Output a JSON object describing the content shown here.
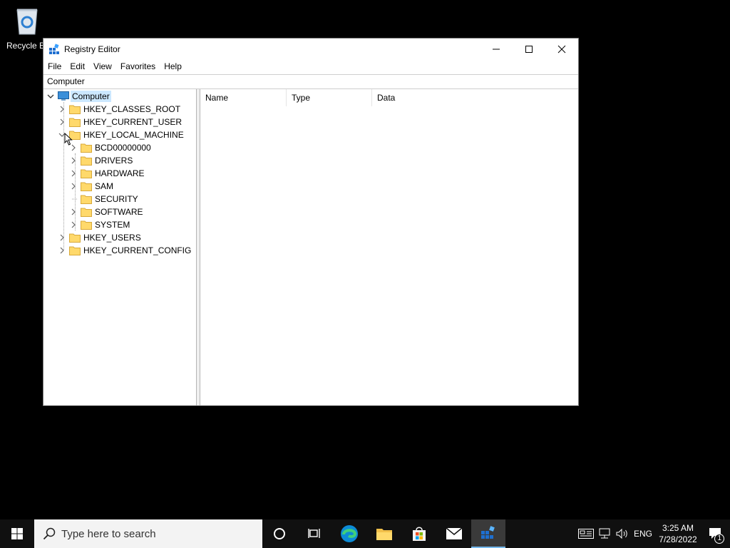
{
  "desktop": {
    "recycle_bin_label": "Recycle B"
  },
  "window": {
    "title": "Registry Editor",
    "menus": [
      "File",
      "Edit",
      "View",
      "Favorites",
      "Help"
    ],
    "address": "Computer",
    "tree": {
      "root": "Computer",
      "hives": [
        {
          "label": "HKEY_CLASSES_ROOT"
        },
        {
          "label": "HKEY_CURRENT_USER"
        },
        {
          "label": "HKEY_LOCAL_MACHINE"
        },
        {
          "label": "HKEY_USERS"
        },
        {
          "label": "HKEY_CURRENT_CONFIG"
        }
      ],
      "hklm_children": [
        "BCD00000000",
        "DRIVERS",
        "HARDWARE",
        "SAM",
        "SECURITY",
        "SOFTWARE",
        "SYSTEM"
      ]
    },
    "columns": [
      "Name",
      "Type",
      "Data"
    ]
  },
  "taskbar": {
    "search_placeholder": "Type here to search",
    "language": "ENG",
    "time": "3:25 AM",
    "date": "7/28/2022",
    "notification_count": "1"
  }
}
